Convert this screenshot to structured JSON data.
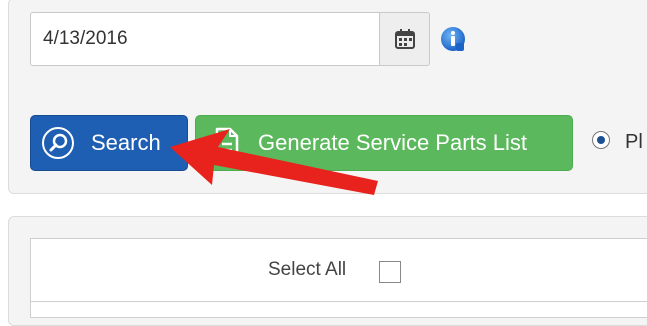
{
  "filter": {
    "date_value": "4/13/2016"
  },
  "buttons": {
    "search_label": "Search",
    "generate_label": "Generate Service Parts List"
  },
  "radio": {
    "label": "Pl",
    "selected": true
  },
  "table": {
    "select_all_label": "Select All",
    "select_all_checked": false
  },
  "colors": {
    "search_button": "#1f5fb3",
    "generate_button": "#5cb85c",
    "annotation_arrow": "#e8221c"
  },
  "icons": {
    "calendar": "calendar-icon",
    "info": "info-icon",
    "search": "search-icon",
    "document": "document-icon",
    "arrow": "arrow-annotation"
  }
}
